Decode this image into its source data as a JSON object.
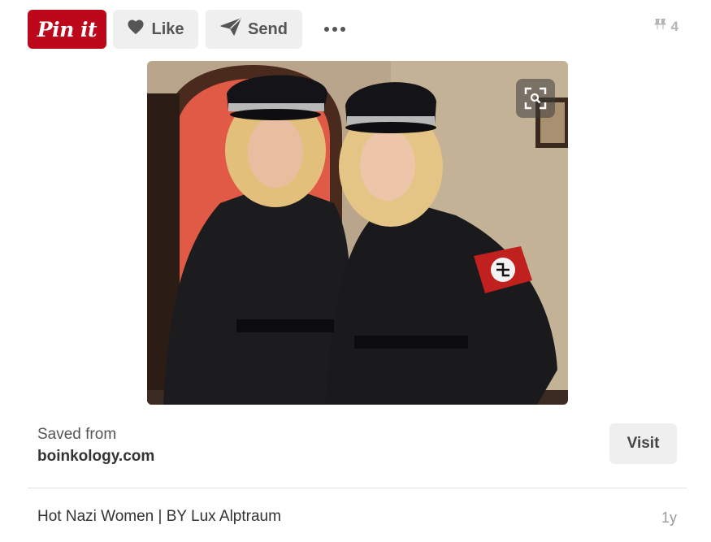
{
  "actions": {
    "pin_it_label": "Pin it",
    "like_label": "Like",
    "send_label": "Send",
    "more_icon": "ellipsis-icon",
    "repin_count": "4",
    "repin_icon": "pushpin-icon"
  },
  "image": {
    "zoom_icon": "visual-search-icon"
  },
  "source": {
    "saved_from_label": "Saved from",
    "domain": "boinkology.com",
    "visit_label": "Visit"
  },
  "pin": {
    "title": "Hot Nazi Women | BY Lux Alptraum",
    "age": "1y"
  },
  "colors": {
    "brand_red": "#bd081c",
    "button_gray": "#efefef"
  }
}
